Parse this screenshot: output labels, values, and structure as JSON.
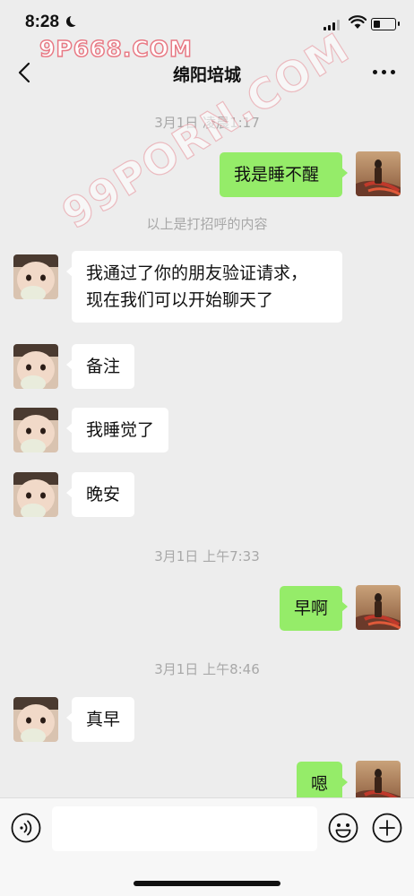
{
  "status_bar": {
    "time": "8:28",
    "battery_level": 0.3
  },
  "watermarks": {
    "top": "9P668.COM",
    "diagonal": "99PORN.COM"
  },
  "header": {
    "title": "绵阳培城"
  },
  "messages": [
    {
      "type": "timestamp",
      "text": "3月1日 凌晨1:17"
    },
    {
      "type": "outgoing",
      "text": "我是睡不醒"
    },
    {
      "type": "system",
      "text": "以上是打招呼的内容"
    },
    {
      "type": "incoming",
      "text": "我通过了你的朋友验证请求，\n现在我们可以开始聊天了"
    },
    {
      "type": "incoming",
      "text": "备注"
    },
    {
      "type": "incoming",
      "text": "我睡觉了"
    },
    {
      "type": "incoming",
      "text": "晚安"
    },
    {
      "type": "timestamp",
      "text": "3月1日 上午7:33"
    },
    {
      "type": "outgoing",
      "text": "早啊"
    },
    {
      "type": "timestamp",
      "text": "3月1日 上午8:46"
    },
    {
      "type": "incoming",
      "text": "真早"
    },
    {
      "type": "outgoing",
      "text": "嗯"
    }
  ],
  "input": {
    "placeholder": ""
  },
  "colors": {
    "background": "#ededed",
    "outgoing_bubble": "#95ec69",
    "incoming_bubble": "#ffffff",
    "timestamp": "#a8a8a8"
  },
  "icons": {
    "back": "chevron-left-icon",
    "more": "more-dots-icon",
    "voice": "voice-icon",
    "emoji": "emoji-icon",
    "plus": "plus-icon"
  }
}
